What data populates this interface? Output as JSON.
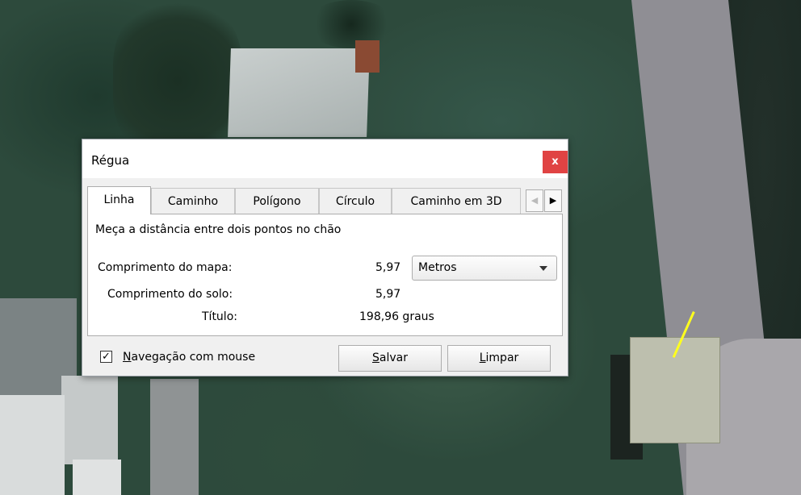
{
  "dialog": {
    "title": "Régua",
    "close_glyph": "x"
  },
  "tabs": [
    {
      "label": "Linha",
      "active": true
    },
    {
      "label": "Caminho",
      "active": false
    },
    {
      "label": "Polígono",
      "active": false
    },
    {
      "label": "Círculo",
      "active": false
    },
    {
      "label": "Caminho em 3D",
      "active": false
    }
  ],
  "tab_scroll": {
    "left_glyph": "◀",
    "right_glyph": "▶"
  },
  "panel": {
    "description": "Meça a distância entre dois pontos no chão",
    "map_length_label": "Comprimento do mapa:",
    "map_length_value": "5,97",
    "unit_selected": "Metros",
    "ground_length_label": "Comprimento do solo:",
    "ground_length_value": "5,97",
    "heading_label": "Título:",
    "heading_value": "198,96 graus"
  },
  "footer": {
    "mouse_nav_checked": true,
    "mouse_nav_check_glyph": "✓",
    "mouse_nav_label_first": "N",
    "mouse_nav_label_rest": "avegação com mouse",
    "save_first": "S",
    "save_rest": "alvar",
    "clear_first": "L",
    "clear_rest": "impar"
  },
  "colors": {
    "close_button": "#e04343",
    "measure_line": "#ffff1e"
  }
}
